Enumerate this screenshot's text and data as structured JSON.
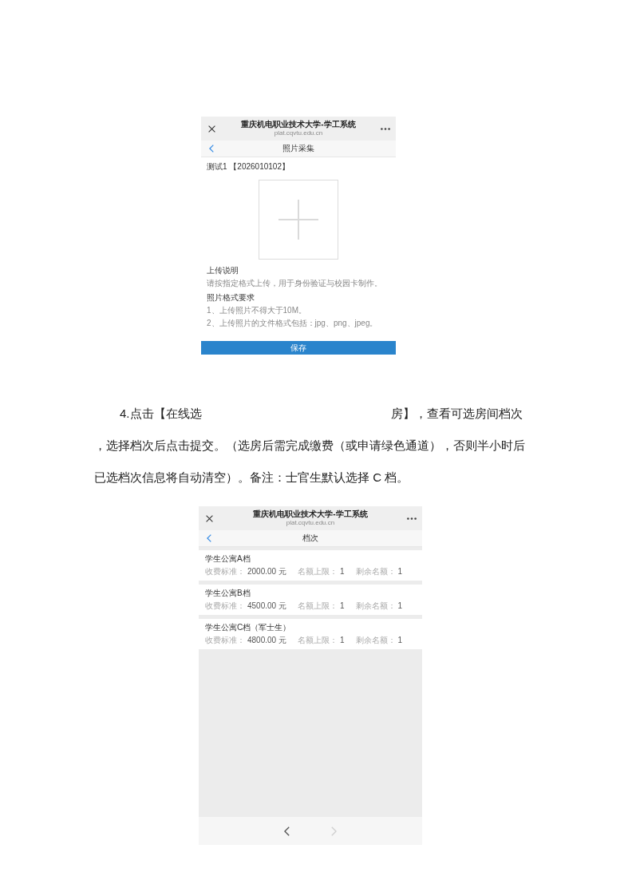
{
  "photo_screen": {
    "window": {
      "title": "重庆机电职业技术大学-学工系统",
      "url": "plat.cqvtu.edu.cn"
    },
    "nav": {
      "title": "照片采集"
    },
    "student": "测试1 【2026010102】",
    "upload_note": {
      "heading": "上传说明",
      "text": "请按指定格式上传，用于身份验证与校园卡制作。"
    },
    "format_rules": {
      "heading": "照片格式要求",
      "items": [
        "1、上传照片不得大于10M。",
        "2、上传照片的文件格式包括：jpg、png、jpeg。"
      ]
    },
    "save_button": "保存"
  },
  "instruction": {
    "first_line": [
      "4.点击【在线选",
      "房】，查看可选房间档次"
    ],
    "text": "，选择档次后点击提交。（选房后需完成缴费（或申请绿色通道），否则半小时后已选档次信息将自动清空）。备注：士官生默认选择 C 档。"
  },
  "tier_screen": {
    "window": {
      "title": "重庆机电职业技术大学-学工系统",
      "url": "plat.cqvtu.edu.cn"
    },
    "nav": {
      "title": "档次"
    },
    "tiers": [
      {
        "name": "学生公寓A档",
        "fields": [
          {
            "label": "收费标准：",
            "value": "2000.00 元"
          },
          {
            "label": "名额上限：",
            "value": "1"
          },
          {
            "label": "剩余名额：",
            "value": "1"
          }
        ]
      },
      {
        "name": "学生公寓B档",
        "fields": [
          {
            "label": "收费标准：",
            "value": "4500.00 元"
          },
          {
            "label": "名额上限：",
            "value": "1"
          },
          {
            "label": "剩余名额：",
            "value": "1"
          }
        ]
      },
      {
        "name": "学生公寓C档（军士生）",
        "fields": [
          {
            "label": "收费标准：",
            "value": "4800.00 元"
          },
          {
            "label": "名额上限：",
            "value": "1"
          },
          {
            "label": "剩余名额：",
            "value": "1"
          }
        ]
      }
    ],
    "toolbar": [
      {
        "kind": "back",
        "disabled": false
      },
      {
        "kind": "forward",
        "disabled": true
      }
    ]
  }
}
